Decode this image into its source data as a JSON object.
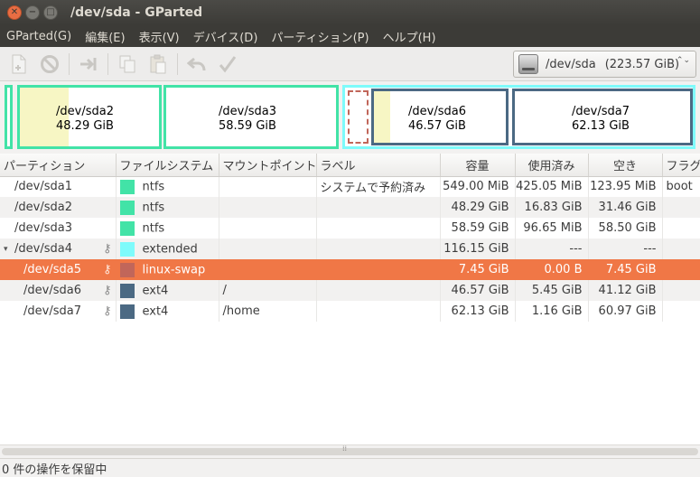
{
  "window": {
    "title": "/dev/sda - GParted",
    "close_glyph": "✕",
    "min_glyph": "−",
    "max_glyph": "□"
  },
  "menu": [
    "GParted(G)",
    "編集(E)",
    "表示(V)",
    "デバイス(D)",
    "パーティション(P)",
    "ヘルプ(H)"
  ],
  "toolbar": {
    "icons": [
      "new-partition-icon",
      "delete-icon",
      "resize-move-icon",
      "copy-icon",
      "paste-icon",
      "undo-icon",
      "apply-icon"
    ],
    "device": {
      "name": "/dev/sda",
      "size": "(223.57 GiB)",
      "arrows": "⌃⌄"
    }
  },
  "map": {
    "sda2": {
      "name": "/dev/sda2",
      "size": "48.29 GiB",
      "used_fraction": 0.35
    },
    "sda3": {
      "name": "/dev/sda3",
      "size": "58.59 GiB"
    },
    "sda6": {
      "name": "/dev/sda6",
      "size": "46.57 GiB",
      "used_fraction": 0.12
    },
    "sda7": {
      "name": "/dev/sda7",
      "size": "62.13 GiB"
    },
    "colors": {
      "ntfs": "#42e3a7",
      "extended": "#7efbfb",
      "swap": "#c1665a",
      "ext4": "#4b6983"
    }
  },
  "table": {
    "headers": [
      "パーティション",
      "ファイルシステム",
      "マウントポイント",
      "ラベル",
      "容量",
      "使用済み",
      "空き",
      "フラグ"
    ],
    "rows": [
      {
        "partition": "/dev/sda1",
        "fs": "ntfs",
        "mount": "",
        "label": "システムで予約済み",
        "size": "549.00 MiB",
        "used": "425.05 MiB",
        "unused": "123.95 MiB",
        "flags": "boot"
      },
      {
        "partition": "/dev/sda2",
        "fs": "ntfs",
        "mount": "",
        "label": "",
        "size": "48.29 GiB",
        "used": "16.83 GiB",
        "unused": "31.46 GiB",
        "flags": ""
      },
      {
        "partition": "/dev/sda3",
        "fs": "ntfs",
        "mount": "",
        "label": "",
        "size": "58.59 GiB",
        "used": "96.65 MiB",
        "unused": "58.50 GiB",
        "flags": ""
      },
      {
        "partition": "/dev/sda4",
        "fs": "extended",
        "mount": "",
        "label": "",
        "size": "116.15 GiB",
        "used": "---",
        "unused": "---",
        "flags": ""
      },
      {
        "partition": "/dev/sda5",
        "fs": "linux-swap",
        "mount": "",
        "label": "",
        "size": "7.45 GiB",
        "used": "0.00 B",
        "unused": "7.45 GiB",
        "flags": ""
      },
      {
        "partition": "/dev/sda6",
        "fs": "ext4",
        "mount": "/",
        "label": "",
        "size": "46.57 GiB",
        "used": "5.45 GiB",
        "unused": "41.12 GiB",
        "flags": ""
      },
      {
        "partition": "/dev/sda7",
        "fs": "ext4",
        "mount": "/home",
        "label": "",
        "size": "62.13 GiB",
        "used": "1.16 GiB",
        "unused": "60.97 GiB",
        "flags": ""
      }
    ],
    "expander_glyph": "▾",
    "key_glyph": "⚷",
    "scroll_grip": "⁞⁞"
  },
  "status": {
    "text": "0 件の操作を保留中"
  }
}
